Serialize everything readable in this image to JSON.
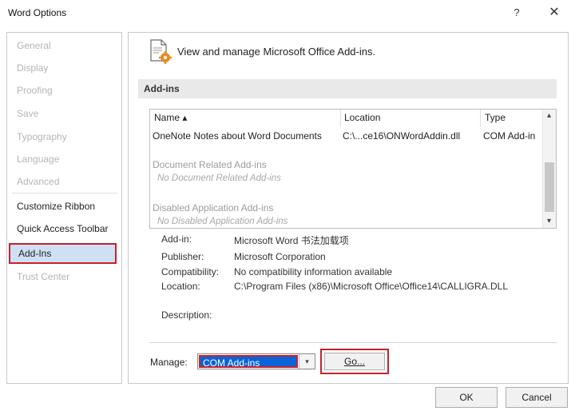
{
  "window": {
    "title": "Word Options",
    "help_label": "?",
    "close_label": "✕"
  },
  "sidebar": {
    "items": [
      {
        "label": "General",
        "state": "disabled"
      },
      {
        "label": "Display",
        "state": "disabled"
      },
      {
        "label": "Proofing",
        "state": "disabled"
      },
      {
        "label": "Save",
        "state": "disabled"
      },
      {
        "label": "Typography",
        "state": "disabled"
      },
      {
        "label": "Language",
        "state": "disabled"
      },
      {
        "label": "Advanced",
        "state": "disabled"
      },
      {
        "label": "Customize Ribbon",
        "state": "enabled"
      },
      {
        "label": "Quick Access Toolbar",
        "state": "enabled"
      },
      {
        "label": "Add-Ins",
        "state": "selected"
      },
      {
        "label": "Trust Center",
        "state": "disabled"
      }
    ]
  },
  "main": {
    "header": "View and manage Microsoft Office Add-ins.",
    "section_title": "Add-ins",
    "list": {
      "columns": [
        "Name ▴",
        "Location",
        "Type"
      ],
      "rows": [
        {
          "name": "OneNote Notes about Word Documents",
          "location": "C:\\...ce16\\ONWordAddin.dll",
          "type": "COM Add-in"
        }
      ],
      "groups": [
        {
          "title": "Document Related Add-ins",
          "empty_text": "No Document Related Add-ins"
        },
        {
          "title": "Disabled Application Add-ins",
          "empty_text": "No Disabled Application Add-ins"
        }
      ],
      "scroll_up": "▴",
      "scroll_down": "▾"
    },
    "details": {
      "addin_label": "Add-in:",
      "addin_value": "Microsoft Word 书法加载项",
      "publisher_label": "Publisher:",
      "publisher_value": "Microsoft Corporation",
      "compat_label": "Compatibility:",
      "compat_value": "No compatibility information available",
      "location_label": "Location:",
      "location_value": "C:\\Program Files (x86)\\Microsoft Office\\Office14\\CALLIGRA.DLL",
      "description_label": "Description:"
    },
    "manage": {
      "label": "Manage:",
      "selected": "COM Add-ins",
      "arrow": "▾",
      "go_label": "Go..."
    }
  },
  "footer": {
    "ok_label": "OK",
    "cancel_label": "Cancel"
  },
  "colors": {
    "selection_blue": "#0a63d8",
    "highlight_red": "#c4232b",
    "sidebar_selected_bg": "#cfe0f5"
  }
}
